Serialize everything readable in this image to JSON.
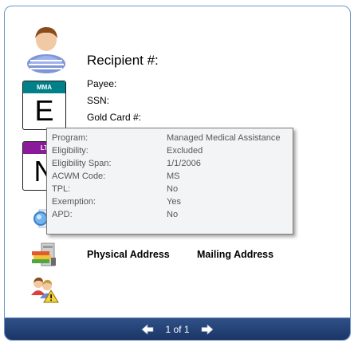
{
  "header": {
    "title": "Recipient #:"
  },
  "fields": [
    {
      "label": "Payee:"
    },
    {
      "label": "SSN:"
    },
    {
      "label": "Gold Card #:"
    }
  ],
  "badges": {
    "mma": {
      "header": "MMA",
      "letter": "E",
      "color": "#00818a"
    },
    "ltc": {
      "header": "LT",
      "letter": "N",
      "color": "#8b1a9a"
    }
  },
  "addresses": {
    "physical": "Physical Address",
    "mailing": "Mailing Address"
  },
  "tooltip": {
    "rows": [
      {
        "label": "Program:",
        "value": "Managed Medical Assistance"
      },
      {
        "label": "Eligibility:",
        "value": "Excluded"
      },
      {
        "label": "Eligibility Span:",
        "value": "1/1/2006"
      },
      {
        "label": "ACWM Code:",
        "value": "MS"
      },
      {
        "label": "TPL:",
        "value": "No"
      },
      {
        "label": "Exemption:",
        "value": "Yes"
      },
      {
        "label": "APD:",
        "value": "No"
      }
    ]
  },
  "pager": {
    "text": "1 of 1"
  },
  "icons": {
    "person": "person-avatar-icon",
    "search": "search-magnifier-icon",
    "address": "address-book-icon",
    "contacts": "contacts-warning-icon",
    "prev": "arrow-left-icon",
    "next": "arrow-right-icon"
  }
}
